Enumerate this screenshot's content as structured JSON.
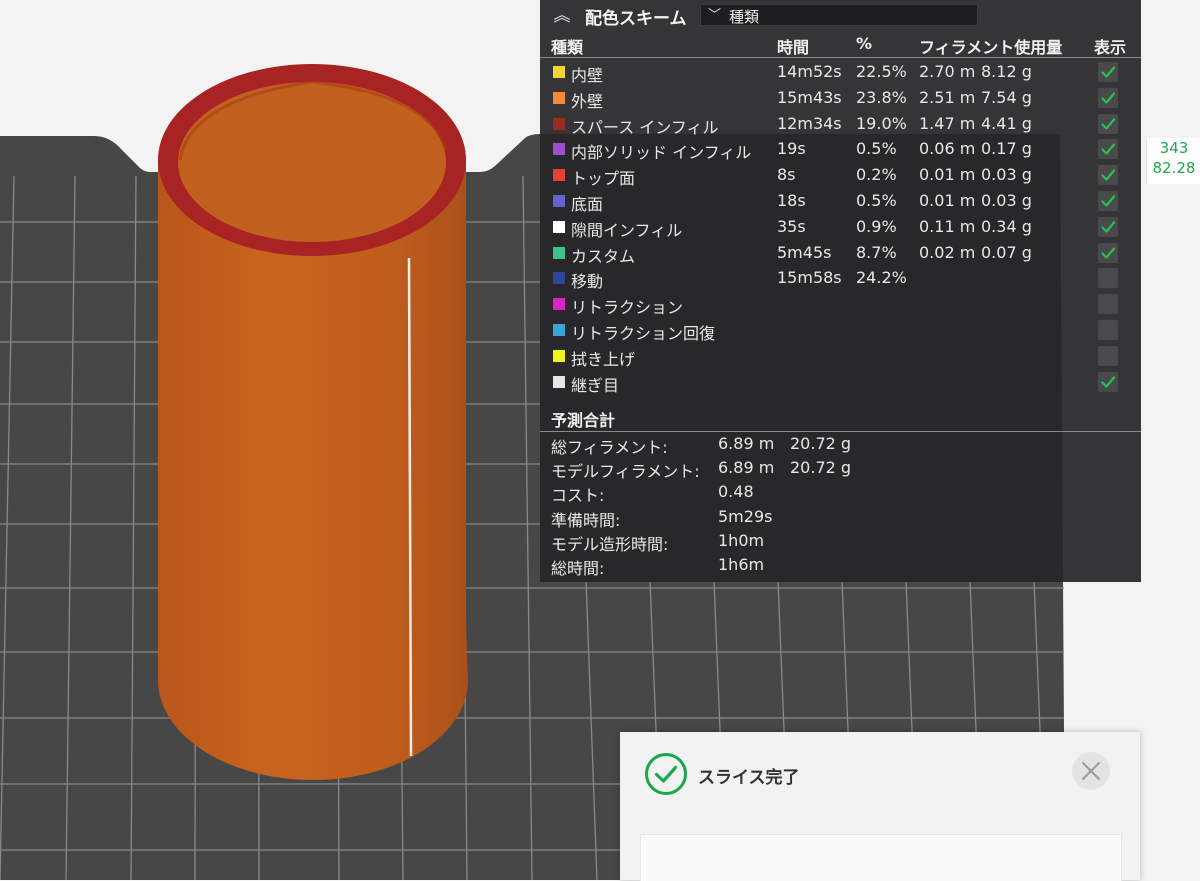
{
  "legend": {
    "title": "配色スキーム",
    "scheme_value": "種類",
    "columns": {
      "type": "種類",
      "time": "時間",
      "percent": "%",
      "filament": "フィラメント使用量",
      "show": "表示"
    },
    "rows": [
      {
        "label": "内壁",
        "color": "#f5d536",
        "time": "14m52s",
        "pct": "22.5%",
        "len": "2.70 m",
        "weight": "8.12 g",
        "shown": true
      },
      {
        "label": "外壁",
        "color": "#f58a3a",
        "time": "15m43s",
        "pct": "23.8%",
        "len": "2.51 m",
        "weight": "7.54 g",
        "shown": true
      },
      {
        "label": "スパース インフィル",
        "color": "#9c2a22",
        "time": "12m34s",
        "pct": "19.0%",
        "len": "1.47 m",
        "weight": "4.41 g",
        "shown": true
      },
      {
        "label": "内部ソリッド インフィル",
        "color": "#9b4fc8",
        "time": "19s",
        "pct": "0.5%",
        "len": "0.06 m",
        "weight": "0.17 g",
        "shown": true
      },
      {
        "label": "トップ面",
        "color": "#e8413a",
        "time": "8s",
        "pct": "0.2%",
        "len": "0.01 m",
        "weight": "0.03 g",
        "shown": true
      },
      {
        "label": "底面",
        "color": "#6b5fd4",
        "time": "18s",
        "pct": "0.5%",
        "len": "0.01 m",
        "weight": "0.03 g",
        "shown": true
      },
      {
        "label": "隙間インフィル",
        "color": "#ffffff",
        "time": "35s",
        "pct": "0.9%",
        "len": "0.11 m",
        "weight": "0.34 g",
        "shown": true
      },
      {
        "label": "カスタム",
        "color": "#3ec38a",
        "time": "5m45s",
        "pct": "8.7%",
        "len": "0.02 m",
        "weight": "0.07 g",
        "shown": true
      },
      {
        "label": "移動",
        "color": "#34449c",
        "time": "15m58s",
        "pct": "24.2%",
        "len": "",
        "weight": "",
        "shown": false
      },
      {
        "label": "リトラクション",
        "color": "#d624c8",
        "time": "",
        "pct": "",
        "len": "",
        "weight": "",
        "shown": false
      },
      {
        "label": "リトラクション回復",
        "color": "#3aa6d8",
        "time": "",
        "pct": "",
        "len": "",
        "weight": "",
        "shown": false
      },
      {
        "label": "拭き上げ",
        "color": "#f2f21a",
        "time": "",
        "pct": "",
        "len": "",
        "weight": "",
        "shown": false
      },
      {
        "label": "継ぎ目",
        "color": "#e6e6e6",
        "time": "",
        "pct": "",
        "len": "",
        "weight": "",
        "shown": true
      }
    ],
    "summary_title": "予測合計",
    "summary": [
      {
        "label": "総フィラメント:",
        "v1": "6.89 m",
        "v2": "20.72 g"
      },
      {
        "label": "モデルフィラメント:",
        "v1": "6.89 m",
        "v2": "20.72 g"
      },
      {
        "label": "コスト:",
        "v1": "0.48",
        "v2": ""
      },
      {
        "label": "準備時間:",
        "v1": "5m29s",
        "v2": ""
      },
      {
        "label": "モデル造形時間:",
        "v1": "1h0m",
        "v2": ""
      },
      {
        "label": "総時間:",
        "v1": "1h6m",
        "v2": ""
      }
    ]
  },
  "side_tag": {
    "top": "343",
    "bottom": "82.28"
  },
  "notification": {
    "message": "スライス完了"
  },
  "colors": {
    "accent_green": "#1aa84b",
    "model_orange": "#c8601a",
    "bed": "#474747"
  },
  "icons": {
    "collapse": "chevron-up-double-icon",
    "dropdown": "chevron-down-icon",
    "check": "check-icon",
    "success": "check-circle-icon",
    "close": "close-icon"
  }
}
